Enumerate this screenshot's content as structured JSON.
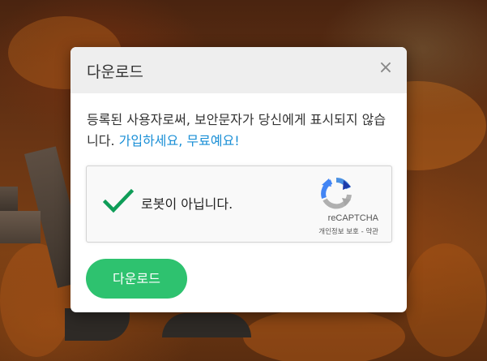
{
  "dialog": {
    "title": "다운로드",
    "close_symbol": "×",
    "message_text": "등록된 사용자로써, 보안문자가 당신에게 표시되지 않습니다. ",
    "signup_link_text": "가입하세요, 무료예요!",
    "captcha": {
      "label": "로봇이 아닙니다.",
      "brand": "reCAPTCHA",
      "privacy_link": "개인정보 보호",
      "separator": " - ",
      "terms_link": "약관",
      "checked": true,
      "check_color": "#0f9d58"
    },
    "download_button_label": "다운로드",
    "accent_color": "#2ec26f",
    "link_color": "#1a8fd6"
  },
  "icons": {
    "close": "close-icon",
    "checkmark": "checkmark-icon",
    "recaptcha": "recaptcha-logo-icon"
  }
}
